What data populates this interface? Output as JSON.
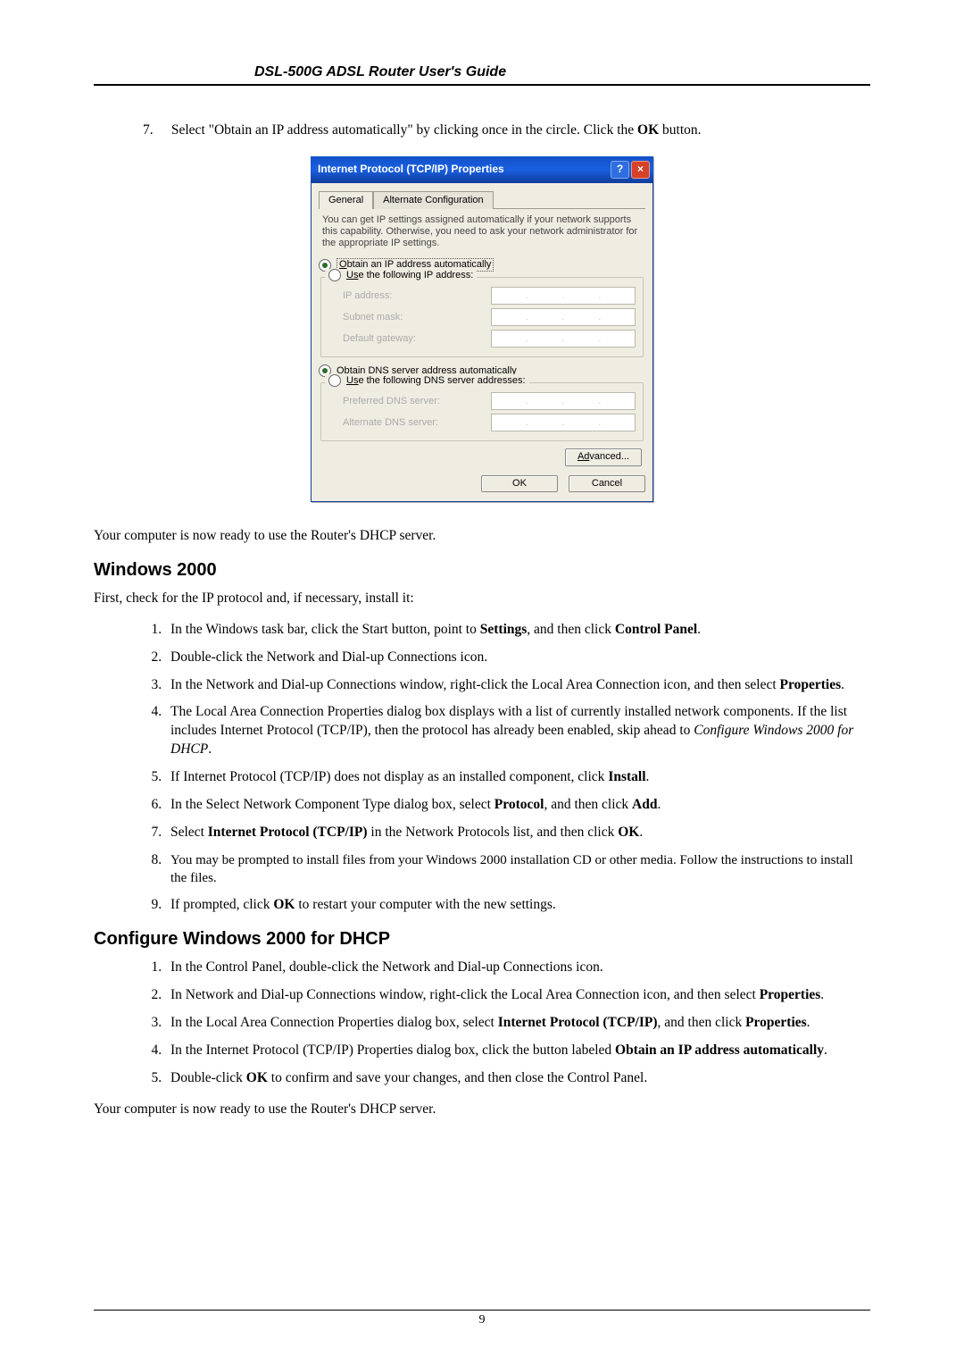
{
  "header": {
    "title": "DSL-500G ADSL Router User's Guide"
  },
  "step7": {
    "num": "7.",
    "text_a": "Select \"Obtain an IP address automatically\" by clicking once in the circle. Click the ",
    "ok": "OK",
    "text_b": " button."
  },
  "dialog": {
    "title": "Internet Protocol (TCP/IP) Properties",
    "tabs": {
      "general": "General",
      "alt": "Alternate Configuration"
    },
    "desc": "You can get IP settings assigned automatically if your network supports this capability. Otherwise, you need to ask your network administrator for the appropriate IP settings.",
    "r_auto_ip_pre": "O",
    "r_auto_ip": "btain an IP address automatically",
    "r_use_ip_pre": "Us",
    "r_use_ip": "e the following IP address:",
    "lbl_ip": "IP address:",
    "lbl_subnet": "Subnet mask:",
    "lbl_gateway": "Default gateway:",
    "r_auto_dns_pre": "Ob",
    "r_auto_dns": "tain DNS server address automatically",
    "r_use_dns_pre": "Us",
    "r_use_dns": "e the following DNS server addresses:",
    "lbl_pref_dns": "Preferred DNS server:",
    "lbl_alt_dns": "Alternate DNS server:",
    "advanced_pre": "Ad",
    "advanced": "vanced...",
    "ok": "OK",
    "cancel": "Cancel"
  },
  "p_ready1": "Your computer is now ready to use the Router's DHCP server.",
  "h_win2000": "Windows 2000",
  "p_first": "First, check for the IP protocol and, if necessary, install it:",
  "list1": {
    "i1_a": "In the Windows task bar, click the Start button, point to ",
    "i1_b": "Settings",
    "i1_c": ", and then click ",
    "i1_d": "Control Panel",
    "i1_e": ".",
    "i2": "Double-click the Network and Dial-up Connections icon.",
    "i3_a": "In the Network and Dial-up Connections window, right-click the Local Area Connection icon, and then select ",
    "i3_b": "Properties",
    "i3_c": ".",
    "i4_a": "The Local Area Connection Properties dialog box displays with a list of currently installed network components. If the list includes Internet Protocol (TCP/IP), then the protocol has already been enabled, skip ahead to ",
    "i4_b": "Configure Windows 2000 for DHCP",
    "i4_c": ".",
    "i5_a": "If Internet Protocol (TCP/IP) does not display as an installed component, click ",
    "i5_b": "Install",
    "i5_c": ".",
    "i6_a": "In the Select Network Component Type dialog box, select ",
    "i6_b": "Protocol",
    "i6_c": ", and then click ",
    "i6_d": "Add",
    "i6_e": ".",
    "i7_a": "Select ",
    "i7_b": "Internet Protocol (TCP/IP)",
    "i7_c": " in the Network Protocols list, and then click ",
    "i7_d": "OK",
    "i7_e": ".",
    "i8": "You may be prompted to install files from your Windows 2000 installation CD or other media. Follow the instructions to install the files.",
    "i9_a": "If prompted, click ",
    "i9_b": "OK",
    "i9_c": " to restart your computer with the new settings."
  },
  "h_conf": "Configure Windows 2000 for DHCP",
  "list2": {
    "i1": "In the Control Panel, double-click the Network and Dial-up Connections icon.",
    "i2_a": "In Network and Dial-up Connections window, right-click the Local Area Connection icon, and then select ",
    "i2_b": "Properties",
    "i2_c": ".",
    "i3_a": "In the Local Area Connection Properties dialog box, select ",
    "i3_b": "Internet Protocol (TCP/IP)",
    "i3_c": ", and then click ",
    "i3_d": "Properties",
    "i3_e": ".",
    "i4_a": "In the Internet Protocol (TCP/IP) Properties dialog box, click the button labeled ",
    "i4_b": "Obtain an IP address automatically",
    "i4_c": ".",
    "i5_a": "Double-click ",
    "i5_b": "OK",
    "i5_c": " to confirm and save your changes, and then close the Control Panel."
  },
  "p_ready2": "Your computer is now ready to use the Router's DHCP server.",
  "footer": {
    "page": "9"
  }
}
